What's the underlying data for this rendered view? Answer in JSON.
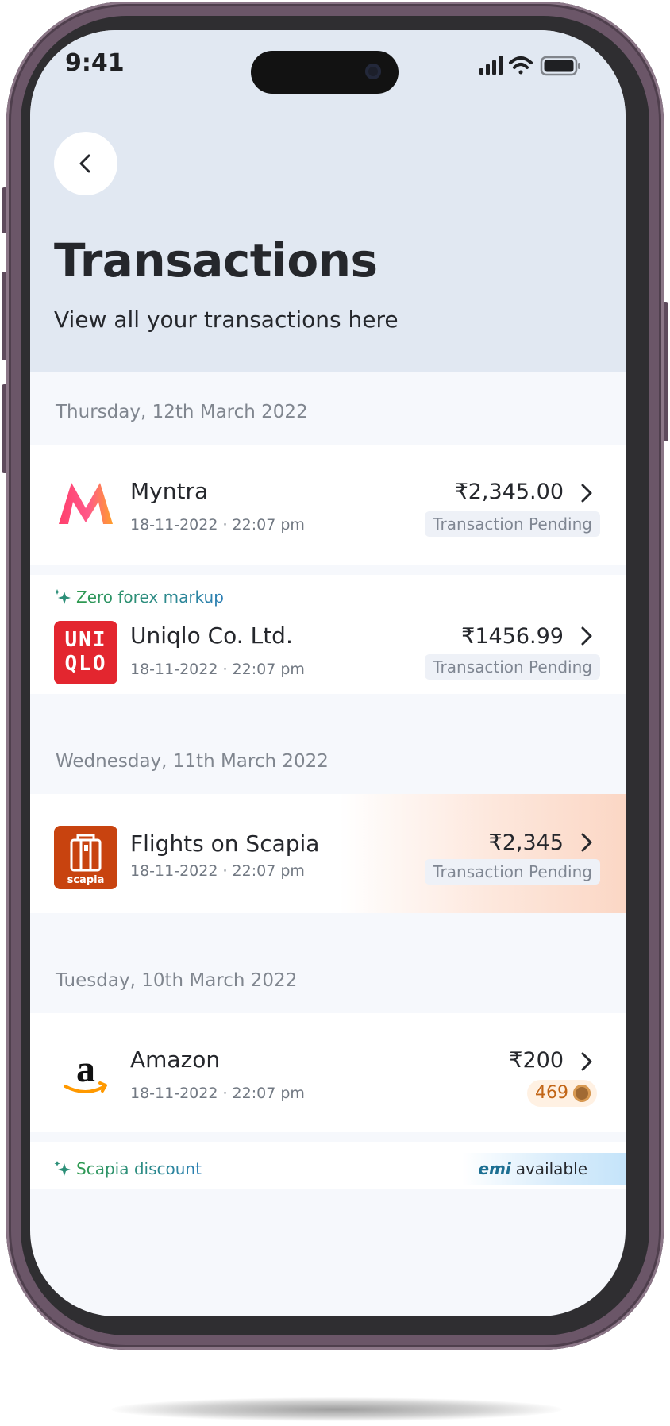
{
  "status_bar": {
    "time": "9:41"
  },
  "header": {
    "title": "Transactions",
    "subtitle": "View all your transactions here"
  },
  "sections": [
    {
      "date": "Thursday, 12th March 2022",
      "transactions": [
        {
          "merchant": "Myntra",
          "datetime": "18-11-2022 · 22:07 pm",
          "amount": "₹2,345.00",
          "status": "Transaction Pending",
          "logo": "myntra-logo"
        },
        {
          "tag": "Zero forex markup",
          "merchant": "Uniqlo Co. Ltd.",
          "datetime": "18-11-2022 · 22:07 pm",
          "amount": "₹1456.99",
          "status": "Transaction Pending",
          "logo": "uniqlo-logo",
          "logo_text_1": "UNI",
          "logo_text_2": "QLO"
        }
      ]
    },
    {
      "date": "Wednesday, 11th March 2022",
      "transactions": [
        {
          "merchant": "Flights on Scapia",
          "datetime": "18-11-2022 · 22:07 pm",
          "amount": "₹2,345",
          "status": "Transaction Pending",
          "logo": "scapia-logo",
          "logo_text": "scapia"
        }
      ]
    },
    {
      "date": "Tuesday, 10th March 2022",
      "transactions": [
        {
          "merchant": "Amazon",
          "datetime": "18-11-2022 · 22:07 pm",
          "amount": "₹200",
          "coins": "469",
          "logo": "amazon-logo"
        },
        {
          "tag": "Scapia discount",
          "emi_label": "emi",
          "emi_text": "available"
        }
      ]
    }
  ],
  "colors": {
    "header_bg": "#e1e8f2",
    "list_bg": "#f6f8fc",
    "card_bg": "#ffffff",
    "badge_bg": "#eef1f7",
    "scapia_orange": "#c8430f",
    "uniqlo_red": "#e3262f",
    "coin_orange": "#c26516"
  }
}
